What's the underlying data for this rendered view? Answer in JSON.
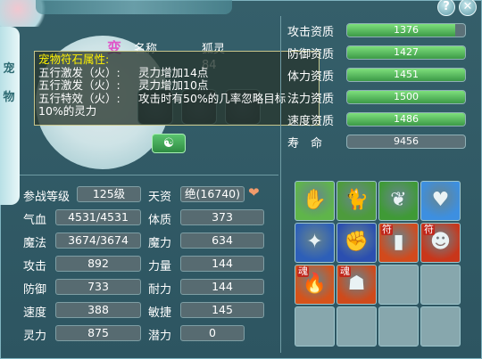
{
  "window": {
    "help_label": "?",
    "close_label": "✕"
  },
  "side_tab": {
    "chars": [
      "宠",
      "物"
    ]
  },
  "pet": {
    "transform_badge": "变",
    "name_label": "名称",
    "name_value": "狐灵",
    "yinyang_icon": "☯"
  },
  "tooltip": {
    "title": "宠物符石属性:",
    "rows": [
      {
        "k": "五行激发（火）:",
        "v": "灵力增加14点"
      },
      {
        "k": "五行激发（火）:",
        "v": "灵力增加10点"
      },
      {
        "k": "五行特效（火）:",
        "v": "攻击时有50%的几率忽略目标"
      }
    ],
    "wrap_line": "10%的灵力",
    "hidden_suffix": "84"
  },
  "qualifications": [
    {
      "label": "攻击资质",
      "value": "1376",
      "fill": 0.92
    },
    {
      "label": "防御资质",
      "value": "1427",
      "fill": 1.0
    },
    {
      "label": "体力资质",
      "value": "1451",
      "fill": 1.0
    },
    {
      "label": "法力资质",
      "value": "1500",
      "fill": 1.0
    },
    {
      "label": "速度资质",
      "value": "1486",
      "fill": 1.0
    },
    {
      "label": "寿　命",
      "value": "9456",
      "fill": 0.0
    }
  ],
  "stats_left": [
    {
      "label": "参战等级",
      "value": "125级"
    },
    {
      "label": "气血",
      "value": "4531/4531"
    },
    {
      "label": "魔法",
      "value": "3674/3674"
    },
    {
      "label": "攻击",
      "value": "892"
    },
    {
      "label": "防御",
      "value": "733"
    },
    {
      "label": "速度",
      "value": "388"
    },
    {
      "label": "灵力",
      "value": "875"
    }
  ],
  "stats_right": [
    {
      "label": "天资",
      "value": "绝(16740)"
    },
    {
      "label": "体质",
      "value": "373"
    },
    {
      "label": "魔力",
      "value": "634"
    },
    {
      "label": "力量",
      "value": "144"
    },
    {
      "label": "耐力",
      "value": "144"
    },
    {
      "label": "敏捷",
      "value": "145"
    },
    {
      "label": "潜力",
      "value": "0"
    }
  ],
  "heart_icon": "❤",
  "skills": [
    {
      "name": "skill-hand",
      "glyph": "✋",
      "bg": "#5fb54a",
      "mark": ""
    },
    {
      "name": "skill-cat",
      "glyph": "🐈",
      "bg": "#4d9b3c",
      "mark": ""
    },
    {
      "name": "skill-nature",
      "glyph": "❦",
      "bg": "#3f9a36",
      "mark": ""
    },
    {
      "name": "skill-heart-shield",
      "glyph": "♥",
      "bg": "#3d8fe0",
      "mark": ""
    },
    {
      "name": "skill-blade",
      "glyph": "✦",
      "bg": "#2d5fb8",
      "mark": ""
    },
    {
      "name": "skill-fist",
      "glyph": "✊",
      "bg": "#2b4fb0",
      "mark": ""
    },
    {
      "name": "skill-talisman",
      "glyph": "▮",
      "bg": "#d24a1c",
      "mark": "符"
    },
    {
      "name": "skill-flame-man",
      "glyph": "☻",
      "bg": "#c9361a",
      "mark": "符"
    },
    {
      "name": "skill-fire-swirl",
      "glyph": "🔥",
      "bg": "#d6531a",
      "mark": "魂"
    },
    {
      "name": "skill-giant",
      "glyph": "☗",
      "bg": "#cf4a1b",
      "mark": "魂"
    },
    {
      "name": "skill-empty-1",
      "glyph": "",
      "bg": "",
      "mark": ""
    },
    {
      "name": "skill-empty-2",
      "glyph": "",
      "bg": "",
      "mark": ""
    },
    {
      "name": "skill-empty-3",
      "glyph": "",
      "bg": "",
      "mark": ""
    },
    {
      "name": "skill-empty-4",
      "glyph": "",
      "bg": "",
      "mark": ""
    },
    {
      "name": "skill-empty-5",
      "glyph": "",
      "bg": "",
      "mark": ""
    },
    {
      "name": "skill-empty-6",
      "glyph": "",
      "bg": "",
      "mark": ""
    }
  ]
}
